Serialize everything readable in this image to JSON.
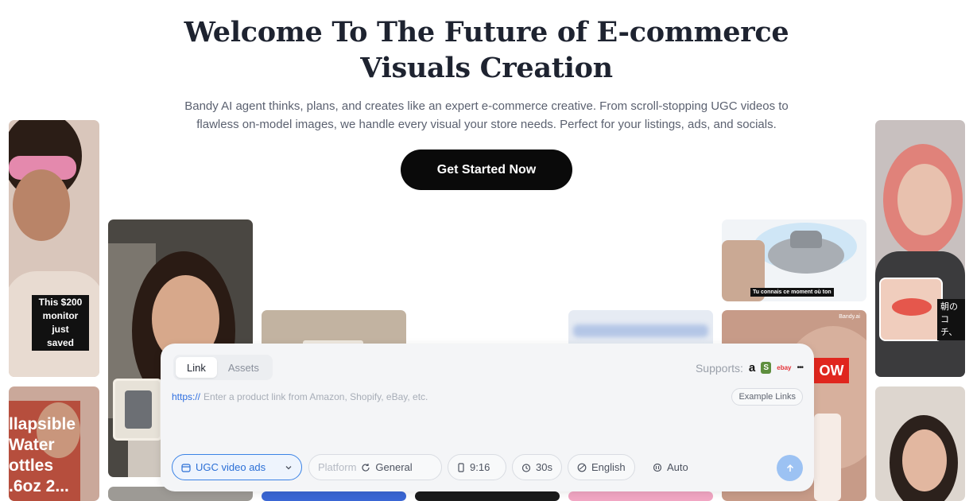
{
  "hero": {
    "title": "Welcome To The Future of E-commerce Visuals Creation",
    "subtitle": "Bandy AI agent thinks, plans, and creates like an expert e-commerce creative. From scroll-stopping UGC videos to flawless on-model images, we handle every visual your store needs. Perfect for your listings, ads, and socials.",
    "cta_label": "Get Started Now"
  },
  "gallery": {
    "monitor_caption_1": "This $200",
    "monitor_caption_2": "monitor just",
    "monitor_caption_3": "saved",
    "bottle_caption_1": "llapsible",
    "bottle_caption_2": "Water",
    "bottle_caption_3": "ottles",
    "bottle_caption_4": ".6oz 2...",
    "french_subtitle": "Tu connais ce moment où ton",
    "watermark": "Bandy.ai",
    "red_badge": "OW",
    "jp_caption_1": "朝のコ",
    "jp_caption_2": "チ、"
  },
  "composer": {
    "tabs": [
      "Link",
      "Assets"
    ],
    "supports_label": "Supports:",
    "supports_logos": [
      "a",
      "S",
      "ebay"
    ],
    "more_label": "•••",
    "url_prefix": "https://",
    "url_placeholder": "Enter a product link from Amazon, Shopify, eBay, etc.",
    "example_links_label": "Example Links",
    "options": {
      "mode": "UGC video ads",
      "platform_label": "Platform",
      "platform_value": "General",
      "ratio": "9:16",
      "duration": "30s",
      "language": "English",
      "voice": "Auto"
    },
    "send_icon": "arrow-up-icon"
  },
  "colors": {
    "cta_bg": "#0a0a0a",
    "accent_blue": "#3b83e6",
    "send_bg": "#9cc2f3"
  }
}
